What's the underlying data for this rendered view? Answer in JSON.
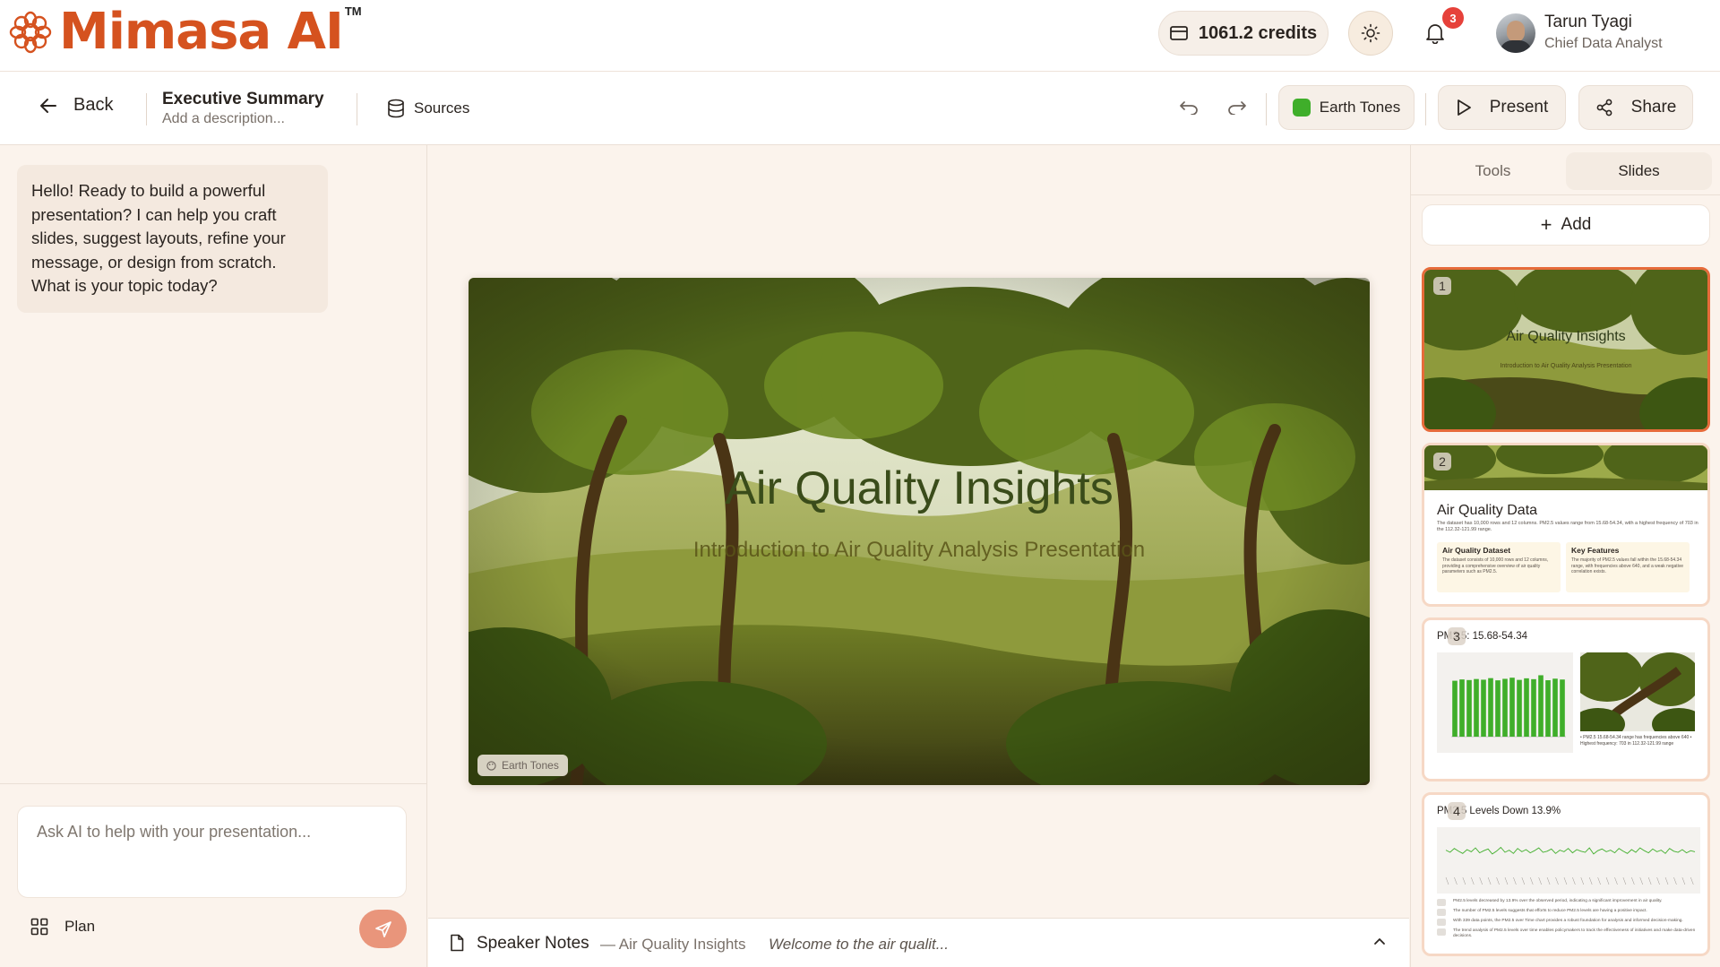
{
  "app": {
    "brand": "Mimasa AI",
    "trademark": "TM"
  },
  "header": {
    "credits": "1061.2 credits",
    "notifications_count": "3",
    "user": {
      "name": "Tarun Tyagi",
      "role": "Chief Data Analyst"
    }
  },
  "toolbar": {
    "back_label": "Back",
    "doc_title": "Executive Summary",
    "doc_description_placeholder": "Add a description...",
    "sources_label": "Sources",
    "theme_label": "Earth Tones",
    "theme_color": "#3fae2a",
    "present_label": "Present",
    "share_label": "Share"
  },
  "chat": {
    "ai_message": "Hello!  Ready to build a powerful presentation? I can help you craft slides, suggest layouts, refine your message, or design from scratch. What is your topic today?",
    "input_placeholder": "Ask AI to help with your presentation...",
    "plan_label": "Plan"
  },
  "slide": {
    "title": "Air Quality Insights",
    "subtitle": "Introduction to Air Quality Analysis Presentation",
    "theme_tag": "Earth Tones"
  },
  "speaker_notes": {
    "label": "Speaker Notes",
    "slide_ref": "— Air Quality Insights",
    "preview": "Welcome to the air qualit..."
  },
  "sidebar": {
    "tabs": [
      {
        "label": "Tools",
        "active": false
      },
      {
        "label": "Slides",
        "active": true
      }
    ],
    "add_label": "Add",
    "slides": [
      {
        "number": "1",
        "title": "Air Quality Insights",
        "subtitle": "Introduction to Air Quality Analysis Presentation"
      },
      {
        "number": "2",
        "title": "Air Quality Data",
        "text": "The dataset has 10,000 rows and 12 columns. PM2.5 values range from 15.68-54.34, with a highest frequency of 703 in the 112.32-121.99 range.",
        "cards": [
          {
            "title": "Air Quality Dataset",
            "text": "The dataset consists of 10,000 rows and 12 columns, providing a comprehensive overview of air quality parameters such as PM2.5."
          },
          {
            "title": "Key Features",
            "text": "The majority of PM2.5 values fall within the 15.68-54.34 range, with frequencies above 640, and a weak negative correlation exists."
          }
        ]
      },
      {
        "number": "3",
        "title": "PM2.5: 15.68-54.34",
        "notes": "• PM2.5 15.68-54.34 range has frequencies above 640 • Highest frequency: 703 in 112.32-121.99 range"
      },
      {
        "number": "4",
        "title": "PM2.5 Levels Down 13.9%",
        "rows": [
          "PM2.5 levels decreased by 13.9% over the observed period, indicating a significant improvement in air quality.",
          "The number of PM2.5 levels suggests that efforts to reduce PM2.5 levels are having a positive impact.",
          "With 339 data points, the PM2.5 over Time chart provides a robust foundation for analysis and informed decision-making.",
          "The trend analysis of PM2.5 levels over time enables policymakers to track the effectiveness of initiatives and make data-driven decisions."
        ]
      }
    ]
  },
  "chart_data": [
    {
      "type": "bar",
      "categories": [
        "1",
        "2",
        "3",
        "4",
        "5",
        "6",
        "7",
        "8",
        "9",
        "10",
        "11",
        "12",
        "13",
        "14",
        "15",
        "16"
      ],
      "values": [
        640,
        655,
        648,
        660,
        652,
        670,
        645,
        662,
        675,
        650,
        668,
        658,
        703,
        646,
        664,
        654
      ],
      "title": "",
      "xlabel": "",
      "ylabel": "",
      "ylim": [
        0,
        800
      ]
    },
    {
      "type": "line",
      "x": [
        1,
        2,
        3,
        4,
        5,
        6,
        7,
        8,
        9,
        10,
        11,
        12,
        13,
        14,
        15,
        16,
        17,
        18,
        19,
        20,
        21,
        22,
        23,
        24,
        25,
        26,
        27,
        28,
        29,
        30,
        31,
        32,
        33,
        34,
        35,
        36,
        37,
        38,
        39,
        40,
        41,
        42,
        43,
        44,
        45,
        46,
        47,
        48,
        49,
        50,
        51,
        52,
        53,
        54,
        55,
        56,
        57,
        58,
        59,
        60
      ],
      "values": [
        52,
        48,
        55,
        50,
        46,
        53,
        49,
        56,
        47,
        51,
        54,
        45,
        50,
        57,
        48,
        52,
        46,
        55,
        49,
        53,
        47,
        51,
        56,
        48,
        50,
        54,
        46,
        52,
        49,
        55,
        47,
        53,
        50,
        48,
        56,
        45,
        51,
        54,
        49,
        52,
        47,
        55,
        50,
        46,
        53,
        48,
        56,
        51,
        47,
        54,
        49,
        52,
        46,
        55,
        50,
        48,
        53,
        47,
        51,
        49
      ],
      "title": "",
      "xlabel": "",
      "ylabel": "",
      "ylim": [
        0,
        100
      ]
    }
  ]
}
